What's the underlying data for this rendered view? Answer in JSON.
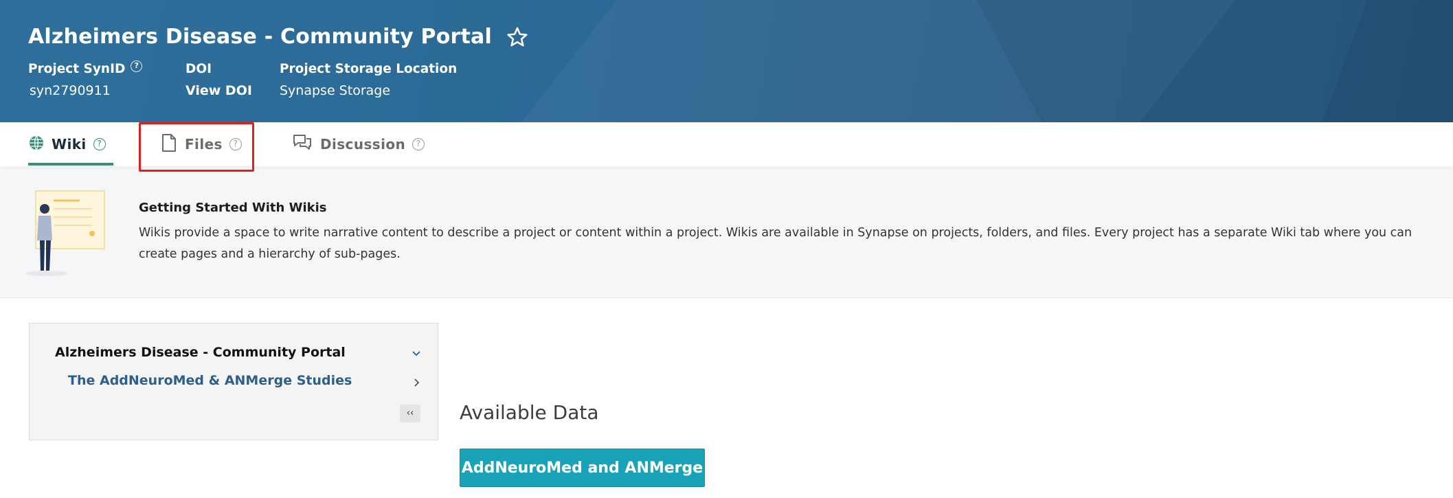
{
  "project": {
    "title": "Alzheimers Disease - Community Portal",
    "synid_label": "Project SynID",
    "synid_value": "syn2790911",
    "doi_label": "DOI",
    "doi_value": "View DOI",
    "storage_label": "Project Storage Location",
    "storage_value": "Synapse Storage",
    "help_glyph": "?"
  },
  "tabs": [
    {
      "label": "Wiki",
      "icon": "globe-icon",
      "active": true
    },
    {
      "label": "Files",
      "icon": "file-icon",
      "active": false
    },
    {
      "label": "Discussion",
      "icon": "chat-bubbles-icon",
      "active": false
    }
  ],
  "tab_help_glyph": "?",
  "info": {
    "title": "Getting Started With Wikis",
    "text": "Wikis provide a space to write narrative content to describe a project or content within a project. Wikis are available in Synapse on projects, folders, and files. Every project has a separate Wiki tab where you can create pages and a hierarchy of sub-pages."
  },
  "wiki_nav": {
    "root": "Alzheimers Disease - Community Portal",
    "children": [
      "The AddNeuroMed & ANMerge Studies"
    ],
    "collapse_label": "‹‹"
  },
  "main": {
    "section_title": "Available Data",
    "button_label": "AddNeuroMed and ANMerge"
  },
  "colors": {
    "header_bg": "#2b6894",
    "active_tab_underline": "#3b8e7e",
    "button_bg": "#1aa3b8",
    "link": "#2d5f8a",
    "highlight_box": "#e02020"
  }
}
